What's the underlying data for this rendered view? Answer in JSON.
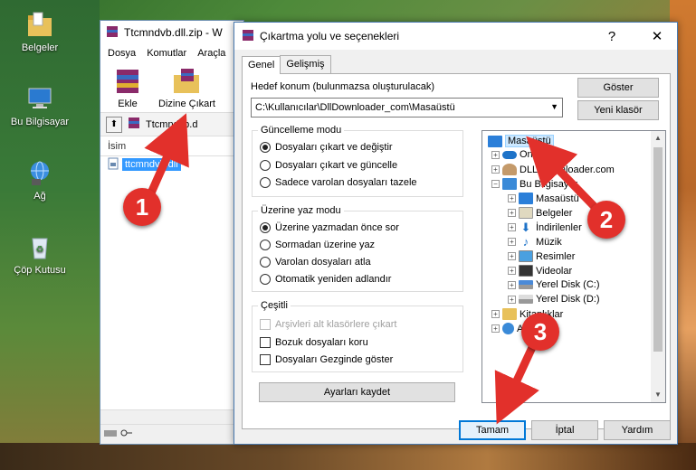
{
  "desktop": {
    "icons": [
      {
        "label": "Belgeler"
      },
      {
        "label": "Bu Bilgisayar"
      },
      {
        "label": "Ağ"
      },
      {
        "label": "Çöp Kutusu"
      }
    ]
  },
  "main_window": {
    "title": "Ttcmndvb.dll.zip - W",
    "menu": [
      "Dosya",
      "Komutlar",
      "Araçla"
    ],
    "toolbar": {
      "add_label": "Ekle",
      "extract_label": "Dizine Çıkart"
    },
    "path": "Ttcmndvb.d",
    "column_name": "İsim",
    "file": "ttcmndvb.dll"
  },
  "dialog": {
    "title": "Çıkartma yolu ve seçenekleri",
    "close_glyph": "✕",
    "help_glyph": "?",
    "tabs": [
      "Genel",
      "Gelişmiş"
    ],
    "destination_label": "Hedef konum (bulunmazsa oluşturulacak)",
    "destination_value": "C:\\Kullanıcılar\\DllDownloader_com\\Masaüstü",
    "show_button": "Göster",
    "new_folder_button": "Yeni klasör",
    "update_mode": {
      "title": "Güncelleme modu",
      "options": [
        "Dosyaları çıkart ve değiştir",
        "Dosyaları çıkart ve güncelle",
        "Sadece varolan dosyaları tazele"
      ],
      "selected": 0
    },
    "overwrite_mode": {
      "title": "Üzerine yaz modu",
      "options": [
        "Üzerine yazmadan önce sor",
        "Sormadan üzerine yaz",
        "Varolan dosyaları atla",
        "Otomatik yeniden adlandır"
      ],
      "selected": 0
    },
    "misc": {
      "title": "Çeşitli",
      "options": [
        "Arşivleri alt klasörlere çıkart",
        "Bozuk dosyaları koru",
        "Dosyaları Gezginde göster"
      ],
      "disabled": [
        true,
        false,
        false
      ]
    },
    "save_settings_button": "Ayarları kaydet",
    "tree": {
      "items": [
        "Masaüstü",
        "OneDrive",
        "DLL Downloader.com",
        "Bu Bilgisayar",
        "Masaüstü",
        "Belgeler",
        "İndirilenler",
        "Müzik",
        "Resimler",
        "Videolar",
        "Yerel Disk (C:)",
        "Yerel Disk (D:)",
        "Kitaplıklar",
        "Ağ"
      ],
      "selected": "Masaüstü"
    },
    "ok_button": "Tamam",
    "cancel_button": "İptal",
    "help_button": "Yardım"
  },
  "callouts": [
    "1",
    "2",
    "3"
  ],
  "colors": {
    "accent": "#0078d7",
    "callout": "#e2302b",
    "selection": "#3399ff"
  }
}
